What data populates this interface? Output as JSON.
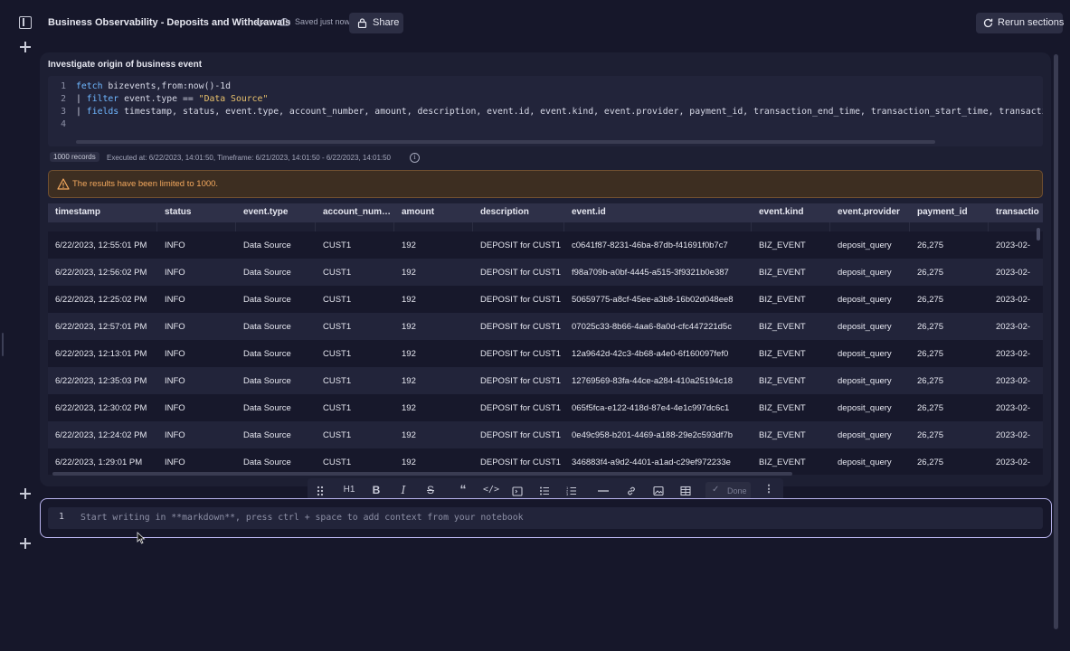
{
  "header": {
    "notebook_title": "Business Observability - Deposits and Withdrawals",
    "saved_status": "Saved just now",
    "share_label": "Share",
    "rerun_label": "Rerun sections"
  },
  "section": {
    "title": "Investigate origin of business event",
    "code_lines": [
      {
        "num": "1",
        "parts": [
          {
            "t": "fetch",
            "c": "kw"
          },
          {
            "t": " bizevents,from:now()-1d",
            "c": ""
          }
        ]
      },
      {
        "num": "2",
        "parts": [
          {
            "t": "| ",
            "c": ""
          },
          {
            "t": " filter",
            "c": "kw"
          },
          {
            "t": " event.type == ",
            "c": ""
          },
          {
            "t": "\"Data Source\"",
            "c": "str"
          }
        ]
      },
      {
        "num": "3",
        "parts": [
          {
            "t": "| ",
            "c": ""
          },
          {
            "t": "fields",
            "c": "kw"
          },
          {
            "t": " timestamp, status, event.type, account_number, amount, description, event.id, event.kind, event.provider, payment_id, transaction_end_time, transaction_start_time, transaction_st",
            "c": ""
          }
        ]
      },
      {
        "num": "4",
        "parts": []
      }
    ],
    "records_badge": "1000 records",
    "execution_info": "Executed at: 6/22/2023, 14:01:50, Timeframe: 6/21/2023, 14:01:50 - 6/22/2023, 14:01:50",
    "warning": "The results have been limited to 1000."
  },
  "table": {
    "columns": [
      "timestamp",
      "status",
      "event.type",
      "account_num…",
      "amount",
      "description",
      "event.id",
      "event.kind",
      "event.provider",
      "payment_id",
      "transactio"
    ],
    "rows": [
      [
        "6/22/2023, 12:55:01 PM",
        "INFO",
        "Data Source",
        "CUST1",
        "192",
        "DEPOSIT for CUST1",
        "c0641f87-8231-46ba-87db-f41691f0b7c7",
        "BIZ_EVENT",
        "deposit_query",
        "26,275",
        "2023-02-"
      ],
      [
        "6/22/2023, 12:56:02 PM",
        "INFO",
        "Data Source",
        "CUST1",
        "192",
        "DEPOSIT for CUST1",
        "f98a709b-a0bf-4445-a515-3f9321b0e387",
        "BIZ_EVENT",
        "deposit_query",
        "26,275",
        "2023-02-"
      ],
      [
        "6/22/2023, 12:25:02 PM",
        "INFO",
        "Data Source",
        "CUST1",
        "192",
        "DEPOSIT for CUST1",
        "50659775-a8cf-45ee-a3b8-16b02d048ee8",
        "BIZ_EVENT",
        "deposit_query",
        "26,275",
        "2023-02-"
      ],
      [
        "6/22/2023, 12:57:01 PM",
        "INFO",
        "Data Source",
        "CUST1",
        "192",
        "DEPOSIT for CUST1",
        "07025c33-8b66-4aa6-8a0d-cfc447221d5c",
        "BIZ_EVENT",
        "deposit_query",
        "26,275",
        "2023-02-"
      ],
      [
        "6/22/2023, 12:13:01 PM",
        "INFO",
        "Data Source",
        "CUST1",
        "192",
        "DEPOSIT for CUST1",
        "12a9642d-42c3-4b68-a4e0-6f160097fef0",
        "BIZ_EVENT",
        "deposit_query",
        "26,275",
        "2023-02-"
      ],
      [
        "6/22/2023, 12:35:03 PM",
        "INFO",
        "Data Source",
        "CUST1",
        "192",
        "DEPOSIT for CUST1",
        "12769569-83fa-44ce-a284-410a25194c18",
        "BIZ_EVENT",
        "deposit_query",
        "26,275",
        "2023-02-"
      ],
      [
        "6/22/2023, 12:30:02 PM",
        "INFO",
        "Data Source",
        "CUST1",
        "192",
        "DEPOSIT for CUST1",
        "065f5fca-e122-418d-87e4-4e1c997dc6c1",
        "BIZ_EVENT",
        "deposit_query",
        "26,275",
        "2023-02-"
      ],
      [
        "6/22/2023, 12:24:02 PM",
        "INFO",
        "Data Source",
        "CUST1",
        "192",
        "DEPOSIT for CUST1",
        "0e49c958-b201-4469-a188-29e2c593df7b",
        "BIZ_EVENT",
        "deposit_query",
        "26,275",
        "2023-02-"
      ],
      [
        "6/22/2023, 1:29:01 PM",
        "INFO",
        "Data Source",
        "CUST1",
        "192",
        "DEPOSIT for CUST1",
        "346883f4-a9d2-4401-a1ad-c29ef972233e",
        "BIZ_EVENT",
        "deposit_query",
        "26,275",
        "2023-02-"
      ]
    ]
  },
  "format_toolbar": {
    "items": [
      "drag-handle",
      "heading",
      "bold",
      "italic",
      "strikethrough",
      "quote",
      "code",
      "code-block",
      "bullet-list",
      "numbered-list",
      "divider",
      "link",
      "image",
      "table"
    ],
    "heading_label": "H1",
    "bold_label": "B",
    "italic_label": "I",
    "strike_label": "S",
    "done_label": "Done"
  },
  "markdown": {
    "line_number": "1",
    "placeholder": "Start writing in **markdown**, press ctrl + space to add context from your notebook"
  },
  "colors": {
    "background": "#16172a",
    "section_bg": "#1d1f33",
    "keyword": "#6fb7ff",
    "string": "#e8c16c",
    "warning_text": "#f4a95e",
    "warning_bg": "#3d2e21",
    "focus_border": "#b9b4ee"
  }
}
